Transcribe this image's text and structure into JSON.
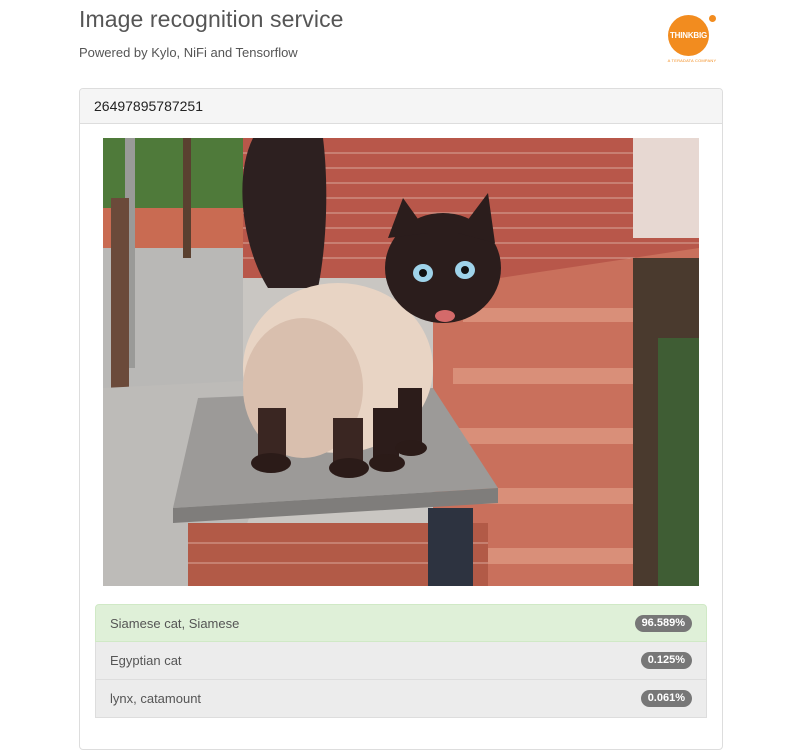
{
  "header": {
    "title": "Image recognition service",
    "subtitle": "Powered by Kylo, NiFi and Tensorflow"
  },
  "logo": {
    "name": "THINKBIG",
    "tagline": "A TERADATA COMPANY",
    "color": "#f28c1f"
  },
  "panel": {
    "image_id": "26497895787251"
  },
  "results": [
    {
      "label": "Siamese cat, Siamese",
      "score": "96.589%",
      "highlight": true
    },
    {
      "label": "Egyptian cat",
      "score": "0.125%",
      "highlight": false
    },
    {
      "label": "lynx, catamount",
      "score": "0.061%",
      "highlight": false
    }
  ],
  "colors": {
    "success_row": "#dff0d8",
    "badge": "#777777"
  }
}
